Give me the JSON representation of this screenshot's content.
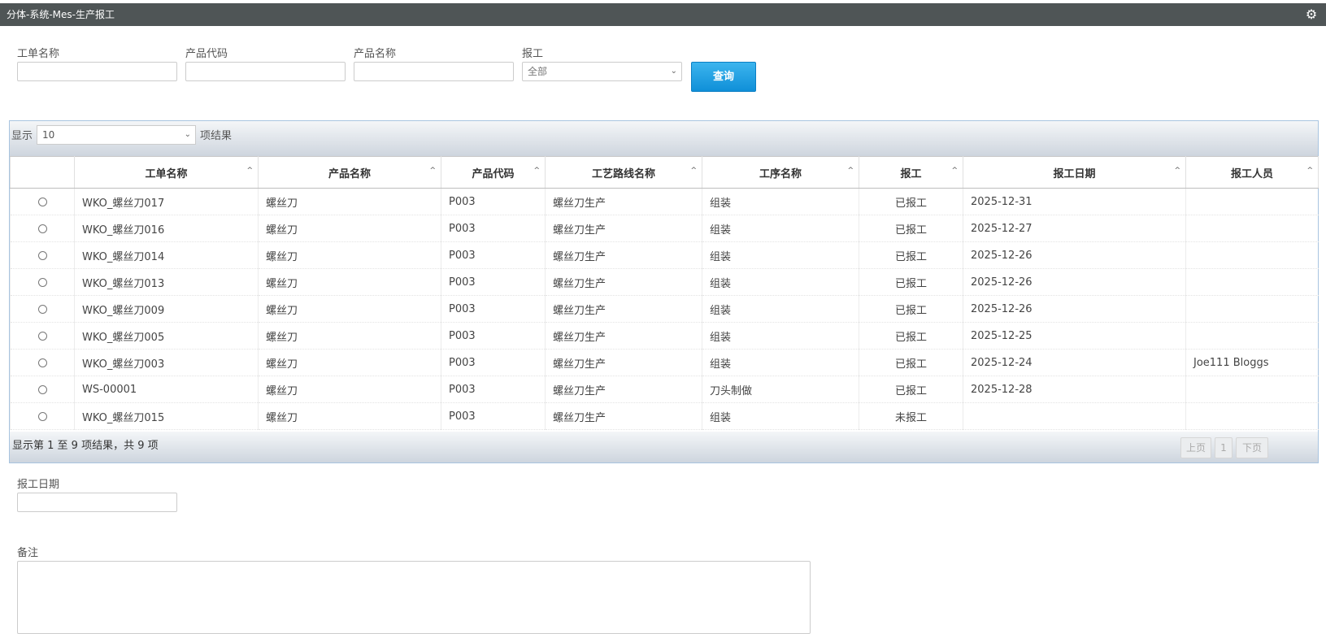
{
  "titlebar": {
    "title": "分体-系统-Mes-生产报工",
    "settings_icon": "gear-icon"
  },
  "filters": {
    "work_order_label": "工单名称",
    "work_order_value": "",
    "product_code_label": "产品代码",
    "product_code_value": "",
    "product_name_label": "产品名称",
    "product_name_value": "",
    "report_label": "报工",
    "report_selected": "全部",
    "query_button": "查询"
  },
  "grid": {
    "show_label": "显示",
    "page_length": "10",
    "results_label": "项结果",
    "columns": [
      "",
      "工单名称",
      "产品名称",
      "产品代码",
      "工艺路线名称",
      "工序名称",
      "报工",
      "报工日期",
      "报工人员"
    ],
    "rows": [
      [
        "WKO_螺丝刀017",
        "螺丝刀",
        "P003",
        "螺丝刀生产",
        "组装",
        "已报工",
        "2025-12-31",
        ""
      ],
      [
        "WKO_螺丝刀016",
        "螺丝刀",
        "P003",
        "螺丝刀生产",
        "组装",
        "已报工",
        "2025-12-27",
        ""
      ],
      [
        "WKO_螺丝刀014",
        "螺丝刀",
        "P003",
        "螺丝刀生产",
        "组装",
        "已报工",
        "2025-12-26",
        ""
      ],
      [
        "WKO_螺丝刀013",
        "螺丝刀",
        "P003",
        "螺丝刀生产",
        "组装",
        "已报工",
        "2025-12-26",
        ""
      ],
      [
        "WKO_螺丝刀009",
        "螺丝刀",
        "P003",
        "螺丝刀生产",
        "组装",
        "已报工",
        "2025-12-26",
        ""
      ],
      [
        "WKO_螺丝刀005",
        "螺丝刀",
        "P003",
        "螺丝刀生产",
        "组装",
        "已报工",
        "2025-12-25",
        ""
      ],
      [
        "WKO_螺丝刀003",
        "螺丝刀",
        "P003",
        "螺丝刀生产",
        "组装",
        "已报工",
        "2025-12-24",
        "Joe111 Bloggs"
      ],
      [
        "WS-00001",
        "螺丝刀",
        "P003",
        "螺丝刀生产",
        "刀头制做",
        "已报工",
        "2025-12-28",
        ""
      ],
      [
        "WKO_螺丝刀015",
        "螺丝刀",
        "P003",
        "螺丝刀生产",
        "组装",
        "未报工",
        "",
        ""
      ]
    ],
    "info": "显示第 1 至 9 项结果，共 9 项",
    "prev_label": "上页",
    "page_number": "1",
    "next_label": "下页"
  },
  "form": {
    "report_date_label": "报工日期",
    "report_date_value": "",
    "remark_label": "备注",
    "remark_value": ""
  }
}
